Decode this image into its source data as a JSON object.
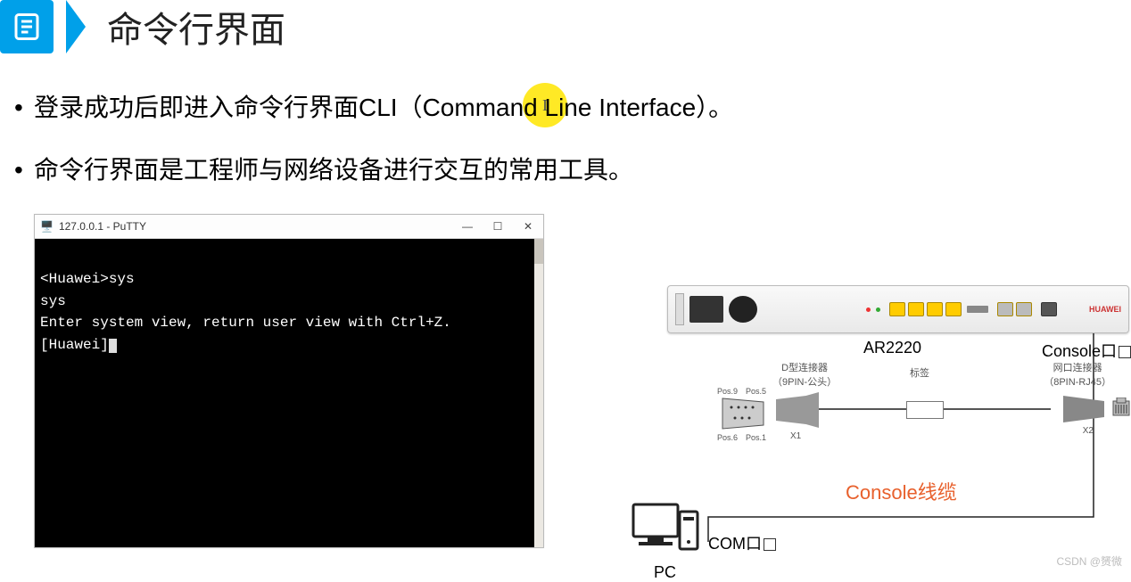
{
  "header": {
    "title": "命令行界面"
  },
  "bullets": {
    "b1": "登录成功后即进入命令行界面CLI（Command Line Interface）。",
    "b2": "命令行界面是工程师与网络设备进行交互的常用工具。"
  },
  "putty": {
    "title": "127.0.0.1 - PuTTY",
    "line1": "<Huawei>sys",
    "line2": "sys",
    "line3": "Enter system view, return user view with Ctrl+Z.",
    "line4": "[Huawei]"
  },
  "diagram": {
    "router_model": "AR2220",
    "router_brand": "HUAWEI",
    "console_port": "Console口",
    "com_port": "COM口",
    "pc_label": "PC",
    "cable_label": "Console线缆",
    "db9_caption": "D型连接器\n（9PIN-公头）",
    "rj45_caption": "网口连接器\n（8PIN-RJ45）",
    "tag_caption": "标签",
    "x1": "X1",
    "x2": "X2",
    "pos9": "Pos.9",
    "pos5": "Pos.5",
    "pos6": "Pos.6",
    "pos1": "Pos.1"
  },
  "watermark": "CSDN @赟微",
  "highlight_cursor": "I"
}
